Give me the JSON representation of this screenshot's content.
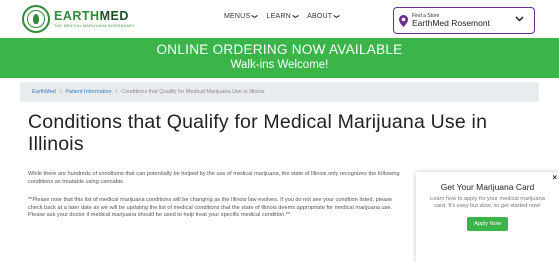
{
  "header": {
    "logo_word_1": "EARTH",
    "logo_word_2": "MED",
    "logo_tagline": "THE MEDICAL MARIJUANA DISPENSARY",
    "nav": [
      {
        "label": "MENUS",
        "icon": "chevron-down-icon"
      },
      {
        "label": "LEARN",
        "icon": "chevron-down-icon"
      },
      {
        "label": "ABOUT",
        "icon": "chevron-down-icon"
      }
    ],
    "store": {
      "label": "Find a Store",
      "name": "EarthMed Rosemont",
      "icon": "map-pin-icon"
    }
  },
  "banner": {
    "line1": "ONLINE ORDERING NOW AVAILABLE",
    "line2": "Walk-ins Welcome!"
  },
  "breadcrumb": {
    "items": [
      "EarthMed",
      "Patient Information"
    ],
    "separator": "/",
    "current": "Conditions that Qualify for Medical Marijuana Use in Illinois"
  },
  "main": {
    "title": "Conditions that Qualify for Medical Marijuana Use in Illinois",
    "para1": "While there are hundreds of conditions that can potentially be helped by the use of medical marijuana, the state of Illinois only recognizes the following conditions as treatable using cannabis.",
    "para2": "**Please note that this list of medical marijuana conditions will be changing as the Illinois law evolves. If you do not see your condition listed, please check back at a later date as we will be updating the list of medical conditions that the state of Illinois deems appropriate for medical marijuana use. Please ask your doctor if medical marijuana should be used to help treat your specific medical condition.**"
  },
  "card": {
    "close": "×",
    "title": "Get Your Marijuana Card",
    "text": "Learn how to apply for your medical marijuana card. It's easy but slow, so get started now!",
    "button": "Apply Now"
  },
  "colors": {
    "brand_green": "#3bb54a",
    "store_border": "#6b2f8a",
    "link_blue": "#3a7cc2"
  }
}
